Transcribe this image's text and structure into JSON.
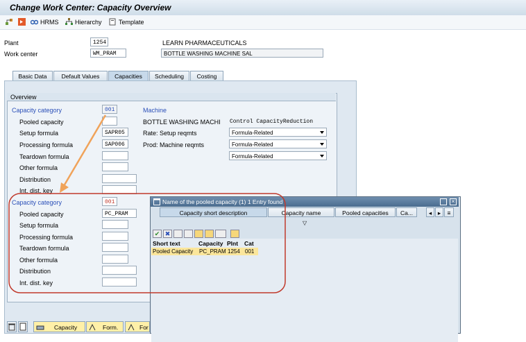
{
  "window": {
    "title": "Change Work Center: Capacity Overview"
  },
  "toolbar": {
    "hrms": "HRMS",
    "hierarchy": "Hierarchy",
    "template": "Template"
  },
  "header": {
    "plant_label": "Plant",
    "plant_value": "1254",
    "plant_desc": "LEARN PHARMACEUTICALS",
    "workcenter_label": "Work center",
    "workcenter_value": "WM_PRAM",
    "workcenter_desc": "BOTTLE WASHING MACHINE SAL"
  },
  "tabs": [
    "Basic Data",
    "Default Values",
    "Capacities",
    "Scheduling",
    "Costing"
  ],
  "overview": {
    "title": "Overview",
    "cap_cat_label": "Capacity category",
    "cap_cat_value": "001",
    "machine_label": "Machine",
    "machine_desc": "BOTTLE WASHING MACHI",
    "control_label": "Control CapacityReduction",
    "pooled_label": "Pooled capacity",
    "setup_label": "Setup formula",
    "setup_value": "SAPR05",
    "processing_label": "Processing formula",
    "processing_value": "SAP006",
    "teardown_label": "Teardown formula",
    "other_label": "Other formula",
    "distribution_label": "Distribution",
    "intdist_label": "Int. dist. key",
    "rate_label": "Rate: Setup reqmts",
    "prod_label": "Prod: Machine reqmts",
    "dropdowns": [
      "Formula-Related",
      "Formula-Related",
      "Formula-Related"
    ]
  },
  "second": {
    "cap_cat_label": "Capacity category",
    "cap_cat_value": "001",
    "pooled_label": "Pooled capacity",
    "pooled_value": "PC_PRAM",
    "setup_label": "Setup formula",
    "processing_label": "Processing formula",
    "teardown_label": "Teardown formula",
    "other_label": "Other formula",
    "distribution_label": "Distribution",
    "intdist_label": "Int. dist. key"
  },
  "popup": {
    "title": "Name of the pooled capacity (1)   1 Entry found",
    "tabs": [
      "Capacity short description",
      "Capacity name",
      "Pooled capacities",
      "Ca..."
    ],
    "columns": [
      "Short text",
      "Capacity",
      "Plnt",
      "Cat"
    ],
    "row": [
      "Pooled Capacity",
      "PC_PRAM",
      "1254",
      "001"
    ]
  },
  "bottom": {
    "capacity": "Capacity",
    "form1": "Form.",
    "form2": "For"
  },
  "colors": {
    "accent_red": "#c0392b",
    "arrow_orange": "#f0a35a",
    "highlight": "#fbe69b"
  }
}
